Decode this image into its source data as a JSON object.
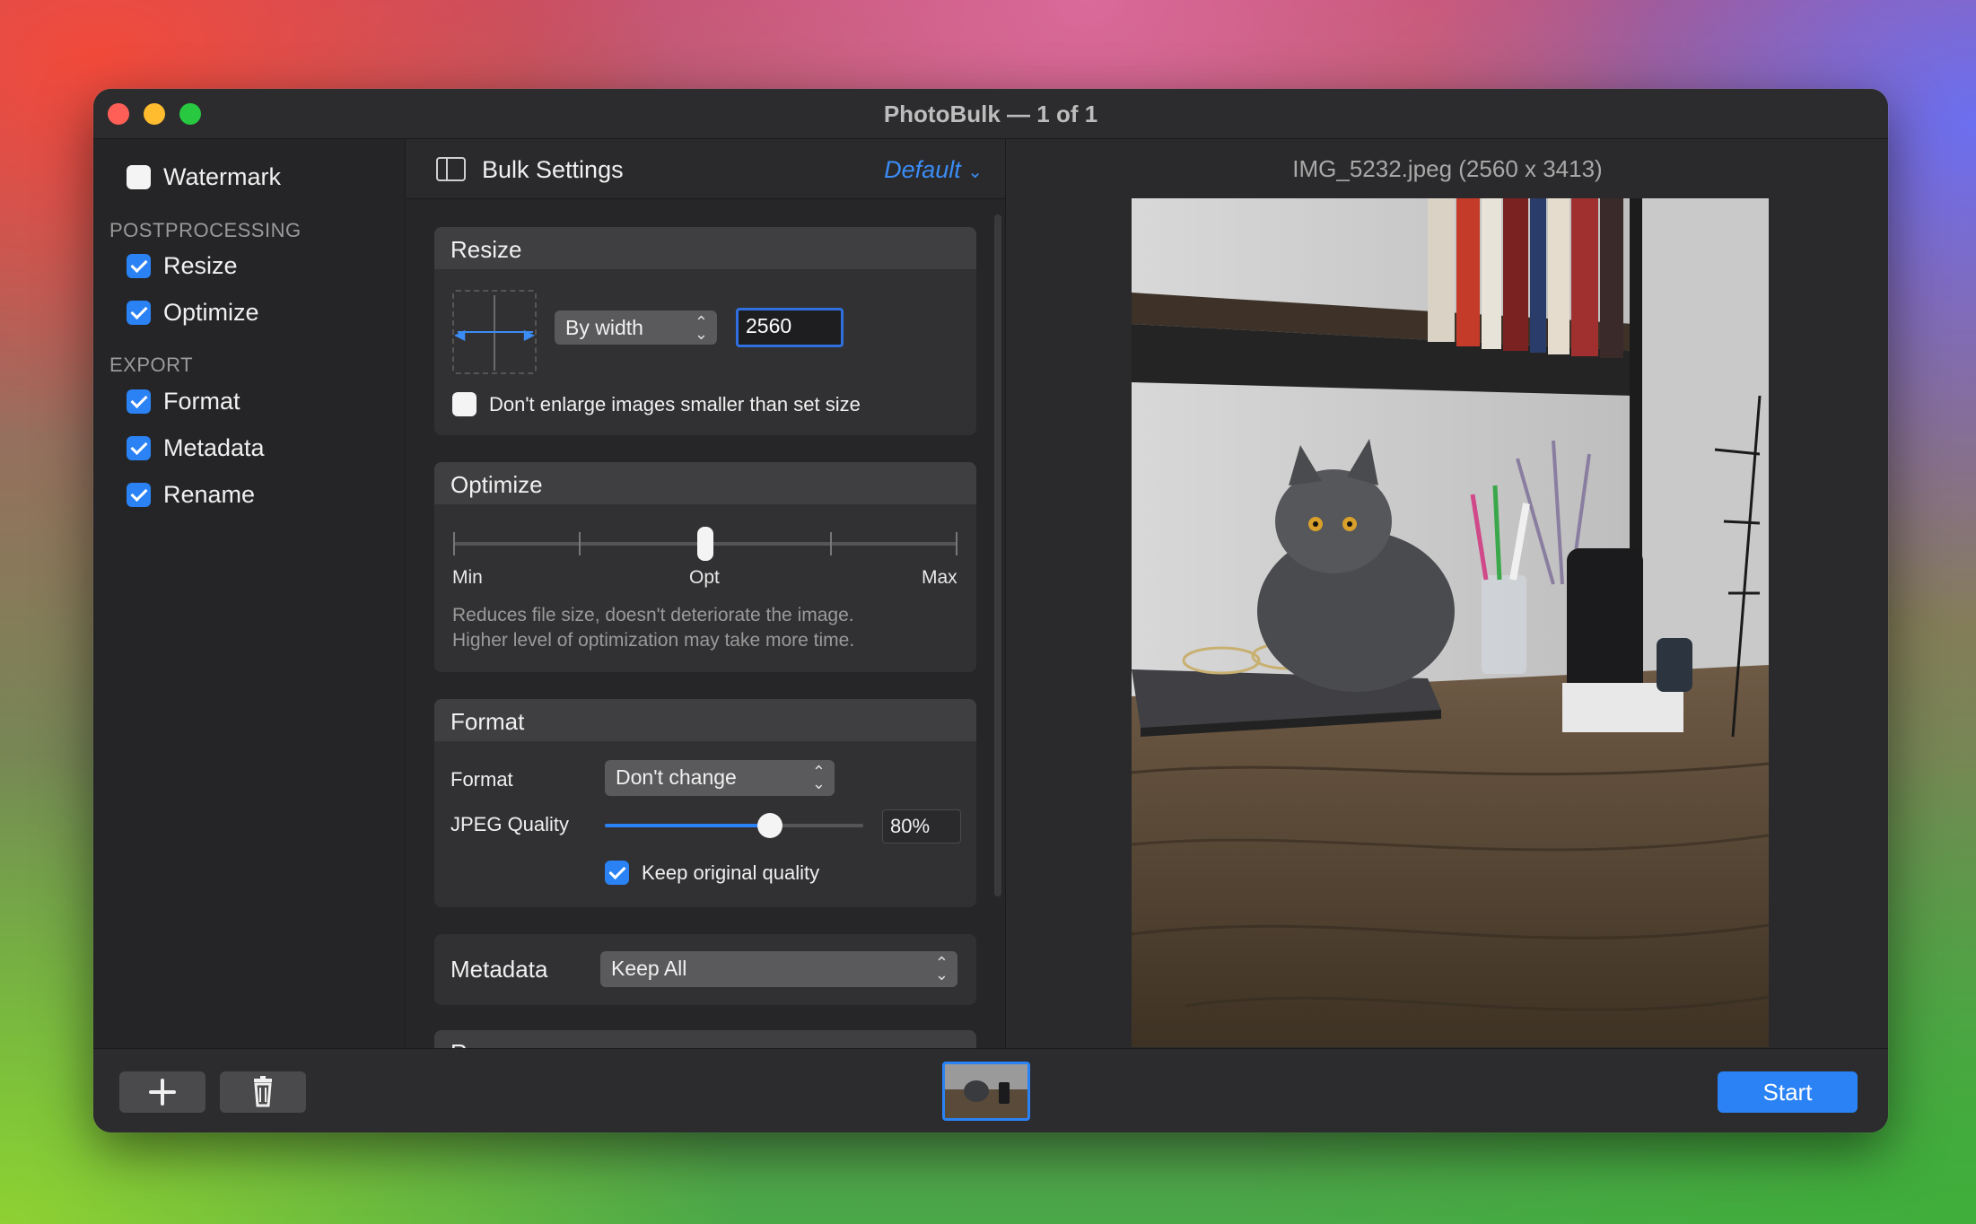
{
  "window": {
    "title": "PhotoBulk — 1 of 1"
  },
  "sidebar": {
    "watermark": {
      "label": "Watermark",
      "checked": false
    },
    "postprocessing_header": "POSTPROCESSING",
    "postprocessing": [
      {
        "label": "Resize",
        "checked": true
      },
      {
        "label": "Optimize",
        "checked": true
      }
    ],
    "export_header": "EXPORT",
    "export": [
      {
        "label": "Format",
        "checked": true
      },
      {
        "label": "Metadata",
        "checked": true
      },
      {
        "label": "Rename",
        "checked": true
      }
    ]
  },
  "settings": {
    "title": "Bulk Settings",
    "preset": "Default",
    "resize": {
      "title": "Resize",
      "mode": "By width",
      "width_value": "2560",
      "dont_enlarge_label": "Don't enlarge images smaller than set size",
      "dont_enlarge_checked": false
    },
    "optimize": {
      "title": "Optimize",
      "min_label": "Min",
      "opt_label": "Opt",
      "max_label": "Max",
      "level_fraction": 0.5,
      "description_line1": "Reduces file size, doesn't deteriorate the image.",
      "description_line2": "Higher level of optimization may take more time."
    },
    "format": {
      "title": "Format",
      "format_label": "Format",
      "format_value": "Don't change",
      "jpeg_quality_label": "JPEG Quality",
      "jpeg_quality_value": "80%",
      "jpeg_quality_fraction": 0.8,
      "keep_original_label": "Keep original quality",
      "keep_original_checked": true
    },
    "metadata": {
      "label": "Metadata",
      "value": "Keep All"
    },
    "rename": {
      "title": "Rename"
    }
  },
  "preview": {
    "filename": "IMG_5232.jpeg (2560 x 3413)"
  },
  "bottom": {
    "add_icon": "plus-icon",
    "delete_icon": "trash-icon",
    "start_label": "Start"
  },
  "colors": {
    "accent": "#2a82f5",
    "link": "#3b8cf5"
  }
}
